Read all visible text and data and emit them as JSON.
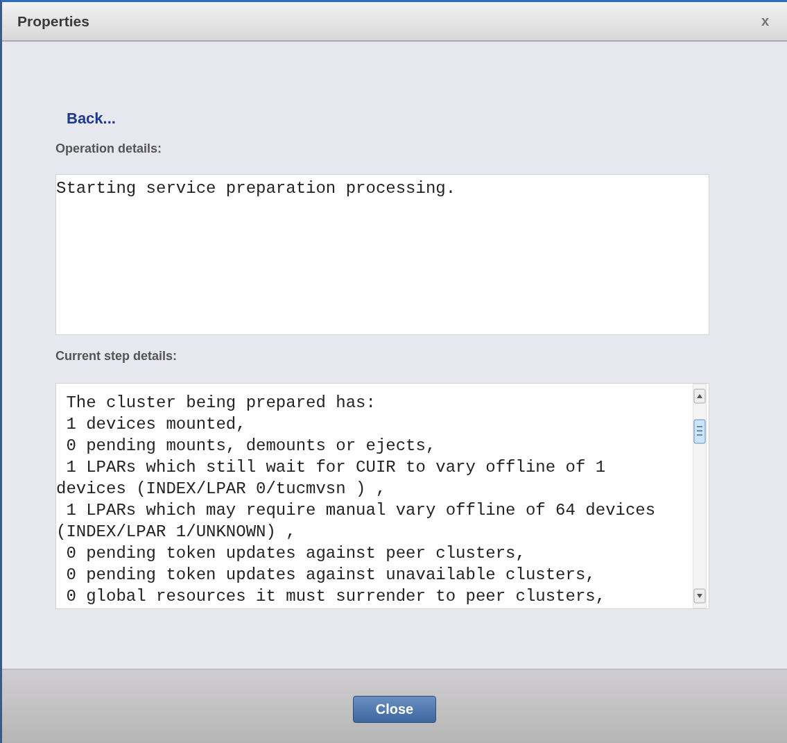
{
  "window": {
    "title": "Properties",
    "close_glyph": "x"
  },
  "back_link": "Back...",
  "operation_details": {
    "label": "Operation details:",
    "text": "Starting service preparation processing."
  },
  "current_step_details": {
    "label": "Current step details:",
    "lines": [
      " The cluster being prepared has:",
      " 1 devices mounted,",
      " 0 pending mounts, demounts or ejects,",
      " 1 LPARs which still wait for CUIR to vary offline of 1",
      "devices (INDEX/LPAR 0/tucmvsn ) ,",
      " 1 LPARs which may require manual vary offline of 64 devices",
      "(INDEX/LPAR 1/UNKNOWN) ,",
      " 0 pending token updates against peer clusters,",
      " 0 pending token updates against unavailable clusters,",
      " 0 global resources it must surrender to peer clusters,"
    ]
  },
  "buttons": [
    "Close"
  ]
}
